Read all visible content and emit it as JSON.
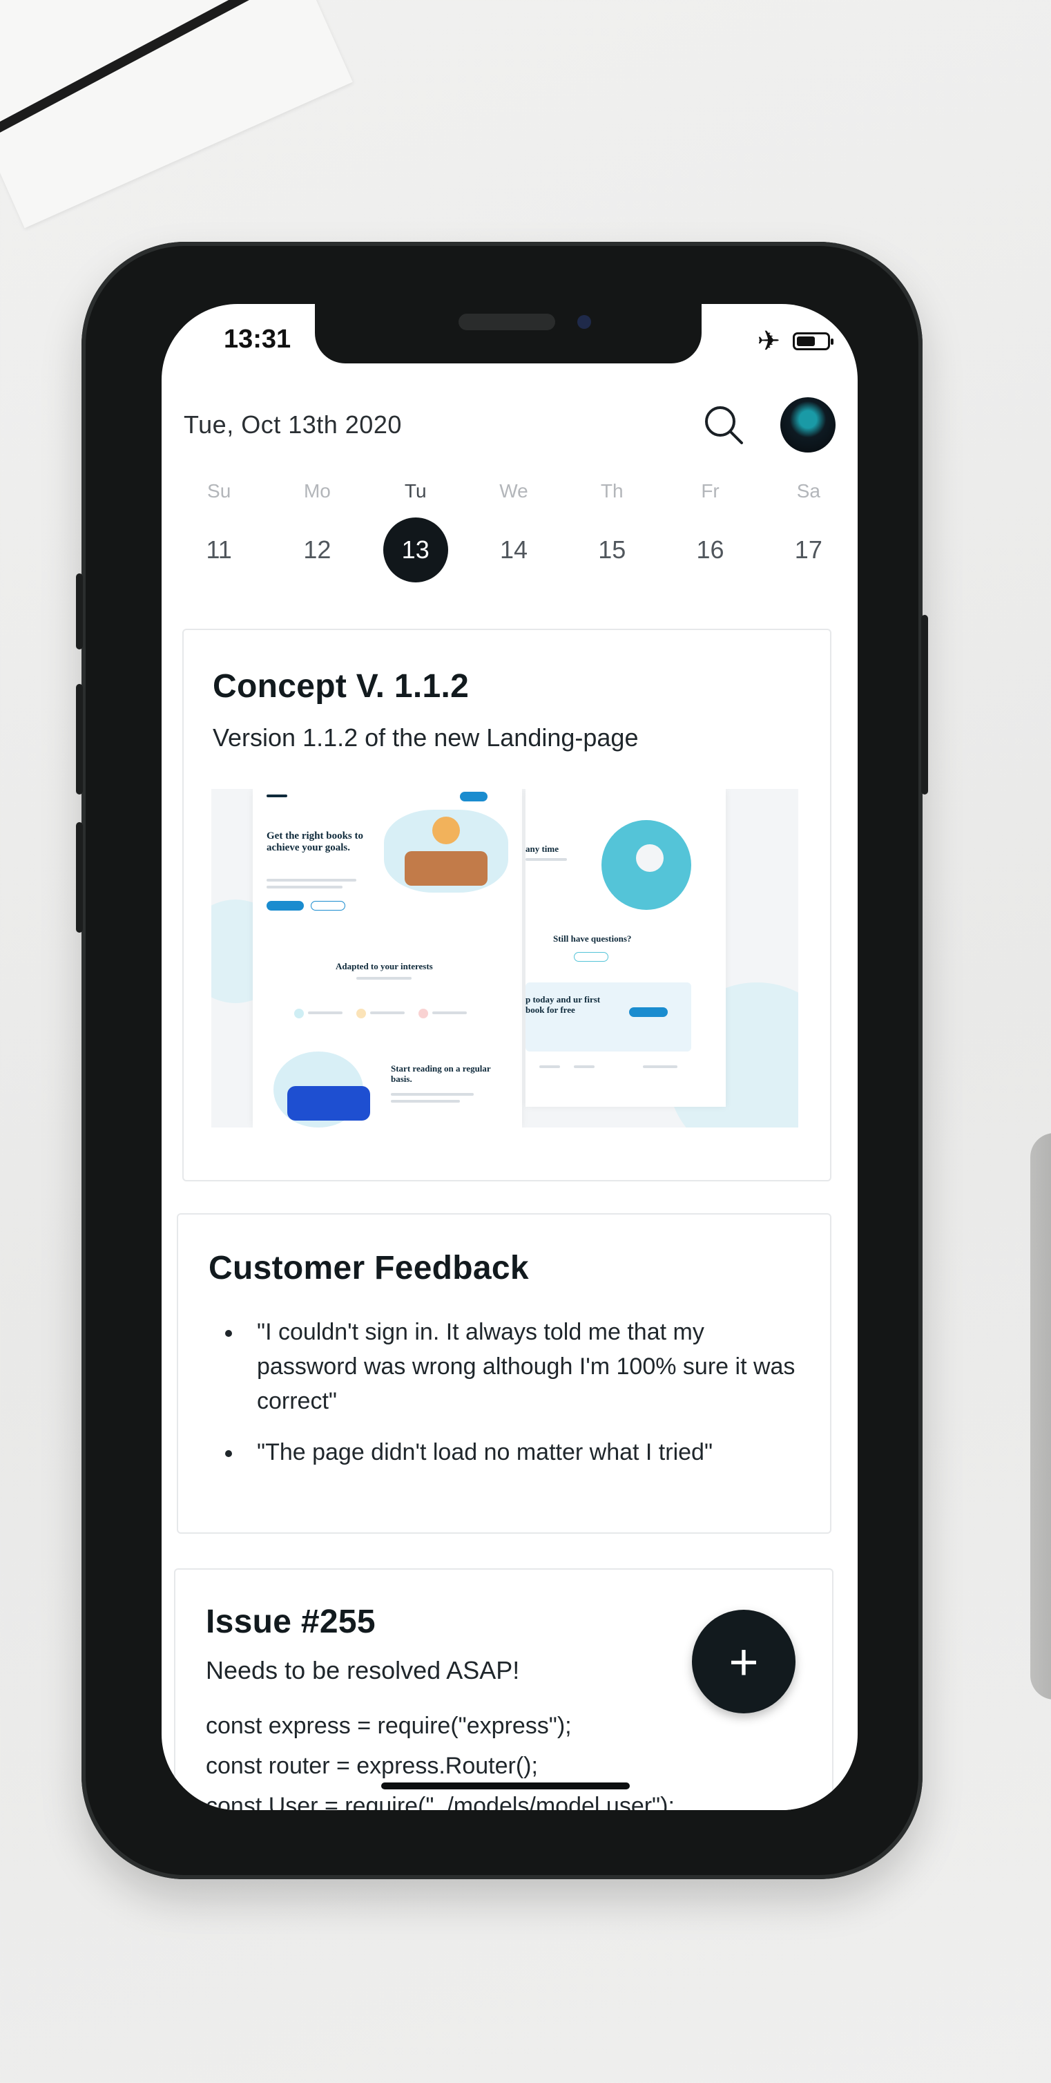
{
  "status_bar": {
    "time": "13:31"
  },
  "header": {
    "date": "Tue, Oct 13th 2020"
  },
  "week": {
    "days": [
      {
        "name": "Su",
        "num": "11"
      },
      {
        "name": "Mo",
        "num": "12"
      },
      {
        "name": "Tu",
        "num": "13"
      },
      {
        "name": "We",
        "num": "14"
      },
      {
        "name": "Th",
        "num": "15"
      },
      {
        "name": "Fr",
        "num": "16"
      },
      {
        "name": "Sa",
        "num": "17"
      }
    ],
    "selected_num": "13"
  },
  "cards": {
    "concept": {
      "title": "Concept V. 1.1.2",
      "subtitle": "Version 1.1.2 of the new Landing-page",
      "preview": {
        "headline": "Get the right books to achieve your goals.",
        "adapted": "Adapted to your interests",
        "questions": "Still have questions?",
        "signup": "p today and ur first book for free",
        "reading": "Start reading on a regular basis.",
        "anytime": "any time"
      }
    },
    "feedback": {
      "title": "Customer Feedback",
      "items": [
        "\"I couldn't sign in. It always told me that my password was wrong although I'm 100% sure it was correct\"",
        "\"The page didn't load no matter what I tried\""
      ]
    },
    "issue": {
      "title": "Issue #255",
      "subtitle": "Needs to be resolved ASAP!",
      "code": [
        "const express = require(\"express\");",
        "const router = express.Router();",
        "const User = require(\"../models/model.user\");"
      ]
    }
  },
  "fab": {
    "label": "+"
  },
  "colors": {
    "accent": "#11171b",
    "preview_blue": "#1a8ccf",
    "preview_teal": "#54c4d8"
  },
  "icons": [
    "airplane-icon",
    "battery-icon",
    "search-icon",
    "avatar",
    "plus-icon"
  ]
}
